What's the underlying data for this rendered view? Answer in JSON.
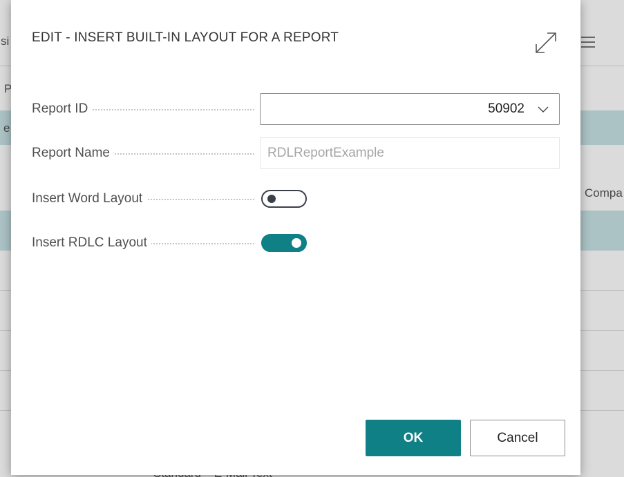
{
  "background": {
    "partial_texts": [
      "si",
      "P",
      "e",
      "Compa",
      "Standard",
      "E-Mail Text"
    ],
    "band_color": "#c9e4e6"
  },
  "dialog": {
    "title": "EDIT - INSERT BUILT-IN LAYOUT FOR A REPORT",
    "expand_icon": "expand-icon",
    "fields": {
      "report_id": {
        "label": "Report ID",
        "value": "50902"
      },
      "report_name": {
        "label": "Report Name",
        "value": "RDLReportExample"
      },
      "insert_word_layout": {
        "label": "Insert Word Layout",
        "checked": false
      },
      "insert_rdlc_layout": {
        "label": "Insert RDLC Layout",
        "checked": true
      }
    },
    "buttons": {
      "ok": "OK",
      "cancel": "Cancel"
    },
    "accent_color": "#0e8086"
  }
}
